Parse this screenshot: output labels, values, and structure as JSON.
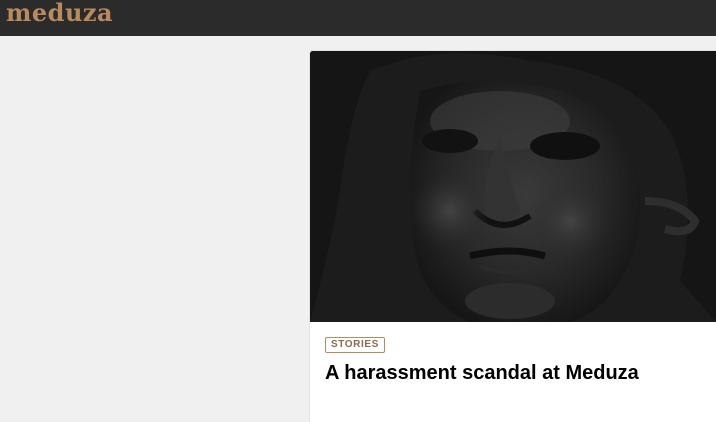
{
  "header": {
    "logo_text": "meduza"
  },
  "card": {
    "badge": "STORIES",
    "title": "A harassment scandal at Meduza",
    "image_description_icon": "sculpture-face-image"
  },
  "colors": {
    "header_bg": "#2b2b2b",
    "logo": "#b98a5e",
    "page_bg": "#f0f0f0",
    "card_bg": "#ffffff",
    "image_bg": "#151515"
  }
}
